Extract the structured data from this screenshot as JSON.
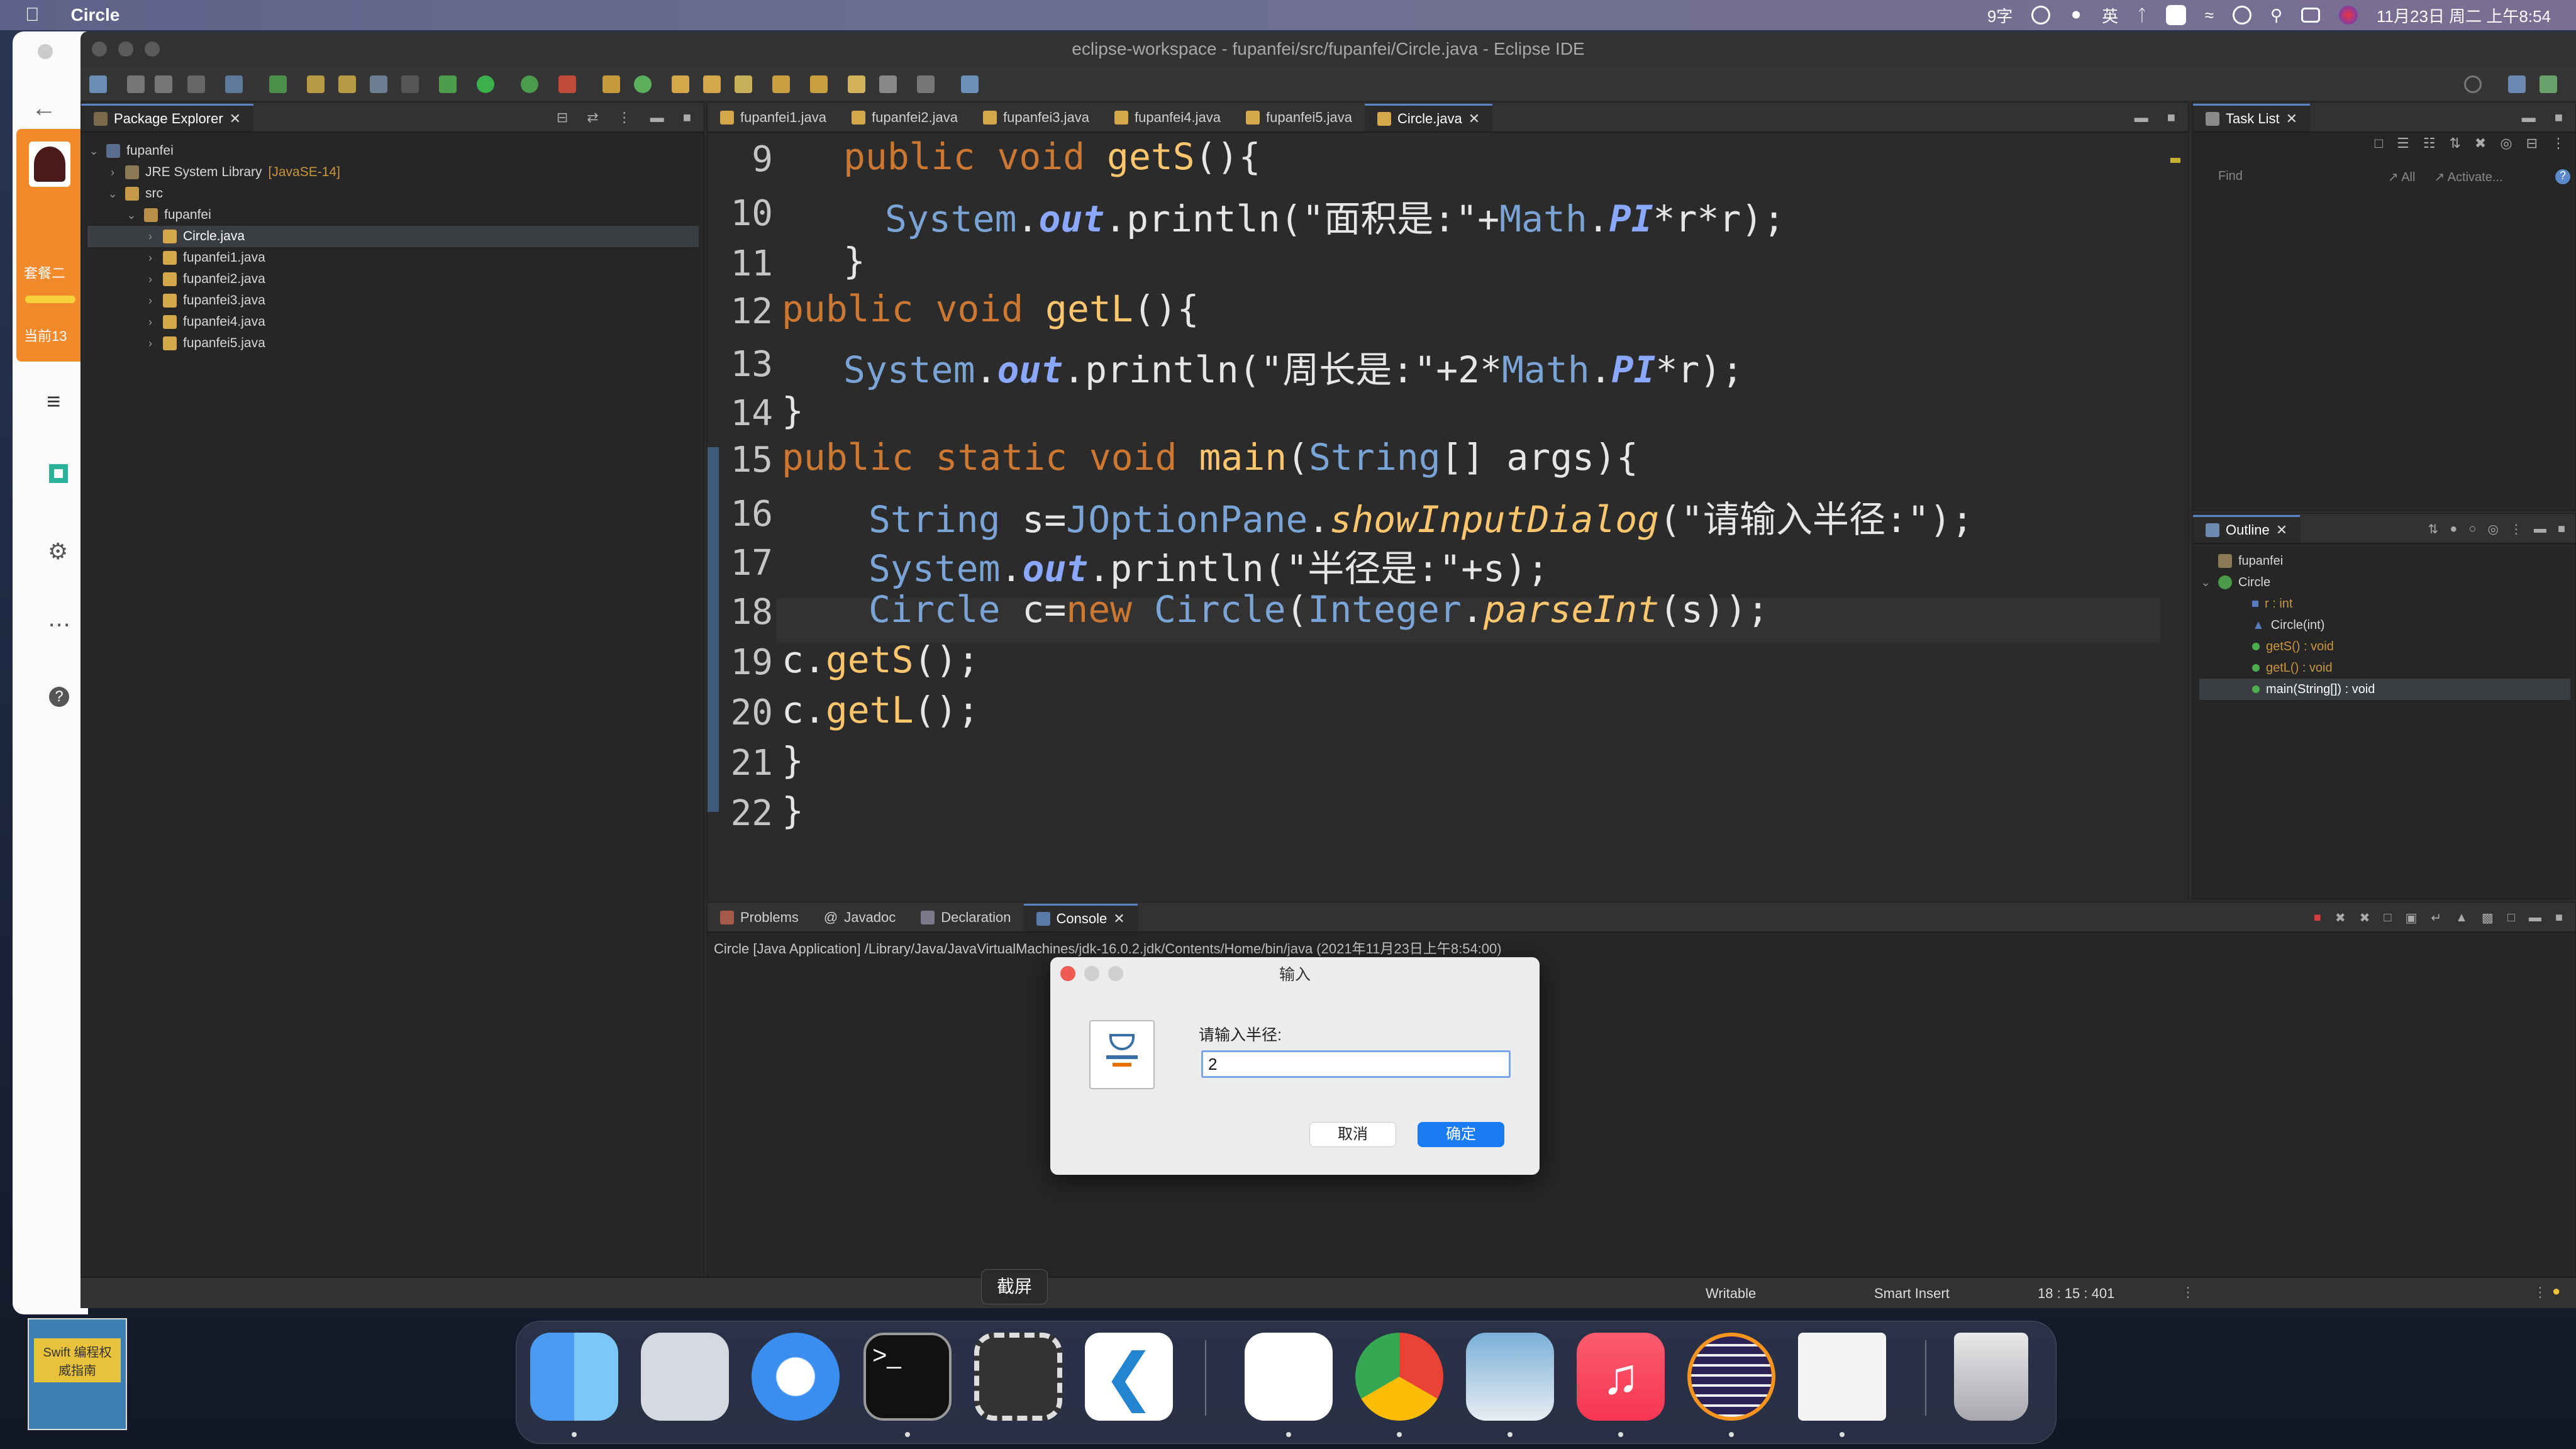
{
  "menubar": {
    "app_name": "Circle",
    "input_status": "9字",
    "input_lang": "英",
    "datetime": "11月23日 周二 上午8:54"
  },
  "left_app": {
    "label1": "套餐二",
    "label2": "当前13"
  },
  "window": {
    "title": "eclipse-workspace - fupanfei/src/fupanfei/Circle.java - Eclipse IDE"
  },
  "package_explorer": {
    "tab_label": "Package Explorer",
    "project": "fupanfei",
    "jre": "JRE System Library",
    "jre_version": "[JavaSE-14]",
    "src": "src",
    "package": "fupanfei",
    "files": [
      "Circle.java",
      "fupanfei1.java",
      "fupanfei2.java",
      "fupanfei3.java",
      "fupanfei4.java",
      "fupanfei5.java"
    ]
  },
  "editor": {
    "tabs": [
      "fupanfei1.java",
      "fupanfei2.java",
      "fupanfei3.java",
      "fupanfei4.java",
      "fupanfei5.java",
      "Circle.java"
    ],
    "active_tab": "Circle.java",
    "line_numbers": [
      "9",
      "10",
      "11",
      "12",
      "13",
      "14",
      "15",
      "16",
      "17",
      "18",
      "19",
      "20",
      "21",
      "22"
    ]
  },
  "task_list": {
    "tab_label": "Task List",
    "find_placeholder": "Find",
    "all_label": "All",
    "activate_label": "Activate..."
  },
  "outline": {
    "tab_label": "Outline",
    "items": [
      "fupanfei",
      "Circle",
      "r : int",
      "Circle(int)",
      "getS() : void",
      "getL() : void",
      "main(String[]) : void"
    ]
  },
  "console": {
    "tabs": [
      "Problems",
      "Javadoc",
      "Declaration",
      "Console"
    ],
    "active_tab": "Console",
    "run_info": "Circle [Java Application] /Library/Java/JavaVirtualMachines/jdk-16.0.2.jdk/Contents/Home/bin/java  (2021年11月23日上午8:54:00)"
  },
  "dialog": {
    "title": "输入",
    "prompt": "请输入半径:",
    "input_value": "2",
    "cancel_label": "取消",
    "ok_label": "确定"
  },
  "status_bar": {
    "writable": "Writable",
    "insert_mode": "Smart Insert",
    "position": "18 : 15 : 401"
  },
  "dock": {
    "tooltip": "截屏",
    "apps": [
      "finder-icon",
      "launchpad-icon",
      "safari-icon",
      "terminal-icon",
      "screenshot-icon",
      "vscode-icon",
      "tencent-meeting-icon",
      "chrome-icon",
      "preview-icon",
      "music-icon",
      "eclipse-icon",
      "java-icon",
      "trash-icon"
    ]
  },
  "desktop": {
    "book_label": "Swift 编程权威指南"
  }
}
